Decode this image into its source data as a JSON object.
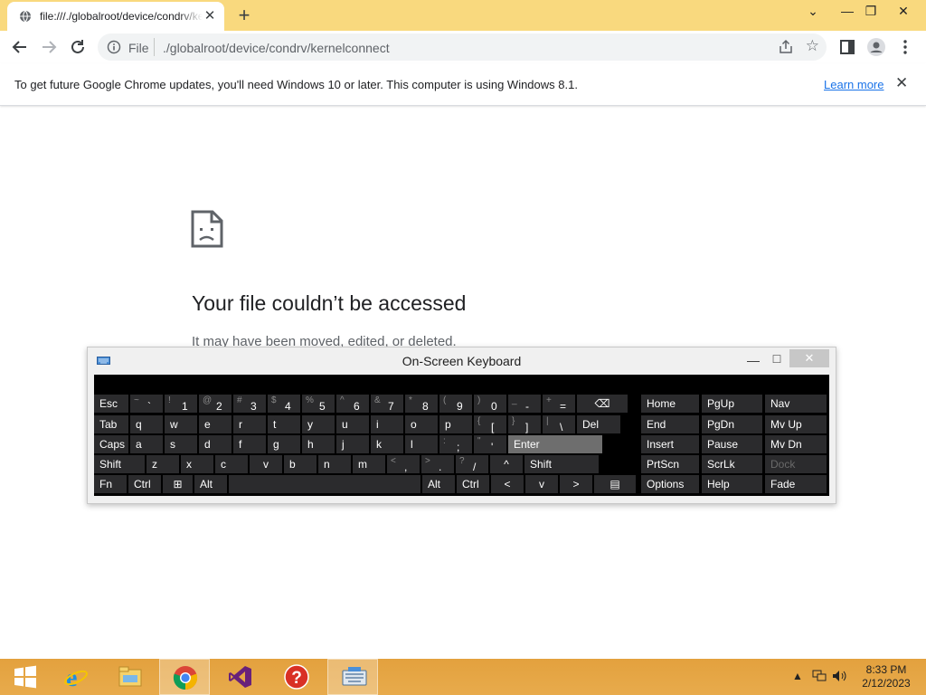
{
  "browser": {
    "tab_title": "file:///./globalroot/device/condrv/kernelconnect",
    "new_tab_label": "+",
    "window_controls": {
      "collapse": "⌄",
      "minimize": "—",
      "restore": "❐",
      "close": "✕"
    },
    "address": {
      "scheme_label": "File",
      "url": "./globalroot/device/condrv/kernelconnect"
    },
    "icons": [
      "back-icon",
      "forward-icon",
      "reload-icon",
      "info-icon",
      "share-icon",
      "star-icon",
      "sidebar-icon",
      "profile-icon",
      "menu-icon"
    ]
  },
  "infobar": {
    "message": "To get future Google Chrome updates, you'll need Windows 10 or later. This computer is using Windows 8.1.",
    "learn_more": "Learn more",
    "close": "✕"
  },
  "error_page": {
    "title": "Your file couldn’t be accessed",
    "subtitle": "It may have been moved, edited, or deleted."
  },
  "osk": {
    "title": "On-Screen Keyboard",
    "min": "—",
    "max": "☐",
    "close": "✕",
    "rows": [
      [
        {
          "label": "Esc"
        },
        {
          "shift": "~",
          "base": "`"
        },
        {
          "shift": "!",
          "base": "1"
        },
        {
          "shift": "@",
          "base": "2"
        },
        {
          "shift": "#",
          "base": "3"
        },
        {
          "shift": "$",
          "base": "4"
        },
        {
          "shift": "%",
          "base": "5"
        },
        {
          "shift": "^",
          "base": "6"
        },
        {
          "shift": "&",
          "base": "7"
        },
        {
          "shift": "*",
          "base": "8"
        },
        {
          "shift": "(",
          "base": "9"
        },
        {
          "shift": ")",
          "base": "0"
        },
        {
          "shift": "_",
          "base": "-"
        },
        {
          "shift": "+",
          "base": "="
        },
        {
          "label": "⌫",
          "icon": "backspace-icon"
        }
      ],
      [
        {
          "label": "Tab"
        },
        {
          "label": "q"
        },
        {
          "label": "w"
        },
        {
          "label": "e"
        },
        {
          "label": "r"
        },
        {
          "label": "t"
        },
        {
          "label": "y"
        },
        {
          "label": "u"
        },
        {
          "label": "i"
        },
        {
          "label": "o"
        },
        {
          "label": "p"
        },
        {
          "shift": "{",
          "base": "["
        },
        {
          "shift": "}",
          "base": "]"
        },
        {
          "shift": "|",
          "base": "\\"
        },
        {
          "label": "Del"
        }
      ],
      [
        {
          "label": "Caps"
        },
        {
          "label": "a"
        },
        {
          "label": "s"
        },
        {
          "label": "d"
        },
        {
          "label": "f"
        },
        {
          "label": "g"
        },
        {
          "label": "h"
        },
        {
          "label": "j"
        },
        {
          "label": "k"
        },
        {
          "label": "l"
        },
        {
          "shift": ":",
          "base": ";"
        },
        {
          "shift": "\"",
          "base": "'"
        },
        {
          "label": "Enter"
        }
      ],
      [
        {
          "label": "Shift"
        },
        {
          "label": "z"
        },
        {
          "label": "x"
        },
        {
          "label": "c"
        },
        {
          "label": "v"
        },
        {
          "label": "b"
        },
        {
          "label": "n"
        },
        {
          "label": "m"
        },
        {
          "shift": "<",
          "base": ","
        },
        {
          "shift": ">",
          "base": "."
        },
        {
          "shift": "?",
          "base": "/"
        },
        {
          "label": "^"
        },
        {
          "label": "Shift"
        }
      ],
      [
        {
          "label": "Fn"
        },
        {
          "label": "Ctrl"
        },
        {
          "label": "⊞",
          "icon": "windows-icon"
        },
        {
          "label": "Alt"
        },
        {
          "label": ""
        },
        {
          "label": "Alt"
        },
        {
          "label": "Ctrl"
        },
        {
          "label": "<"
        },
        {
          "label": "v"
        },
        {
          "label": ">"
        },
        {
          "label": "▤",
          "icon": "context-menu-icon"
        }
      ]
    ],
    "nav_rows": [
      [
        "Home",
        "PgUp",
        "Nav"
      ],
      [
        "End",
        "PgDn",
        "Mv Up"
      ],
      [
        "Insert",
        "Pause",
        "Mv Dn"
      ],
      [
        "PrtScn",
        "ScrLk",
        "Dock"
      ],
      [
        "Options",
        "Help",
        "Fade"
      ]
    ]
  },
  "taskbar": {
    "apps": [
      "start-icon",
      "internet-explorer-icon",
      "file-explorer-icon",
      "chrome-icon",
      "visual-studio-icon",
      "help-icon",
      "on-screen-keyboard-icon"
    ],
    "tray_icons": [
      "show-hidden-icons-icon",
      "network-icon",
      "volume-icon"
    ],
    "time": "8:33 PM",
    "date": "2/12/2023",
    "colors": {
      "taskbar": "#e3a13e",
      "tab_strip": "#f9d97e"
    }
  }
}
